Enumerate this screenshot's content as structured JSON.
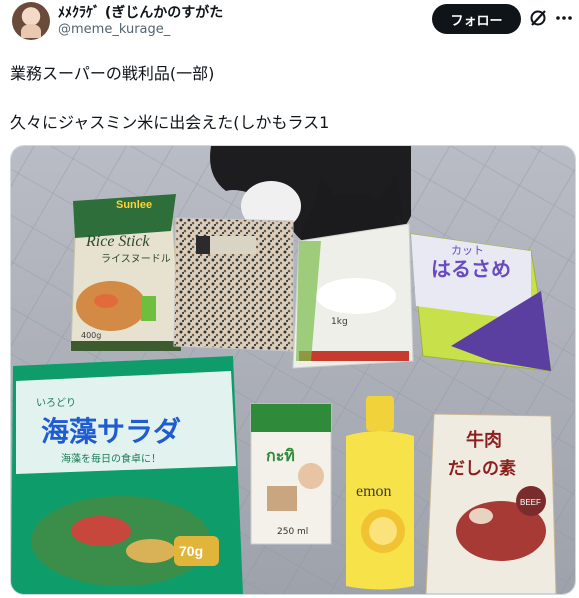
{
  "post": {
    "author_name": "ﾒﾒｸﾗｹﾞ (ぎじんかのすがた",
    "author_handle": "@meme_kurage_",
    "follow_label": "フォロー",
    "text_line1": "業務スーパーの戦利品(一部)",
    "text_line2": "久々にジャスミン米に出会えた(しかもラス1"
  },
  "photo": {
    "noodle_brand": "Sunlee",
    "noodle_name": "Rice Stick",
    "noodle_sub": "ライスヌードル",
    "noodle_weight": "400g",
    "harusame_label": "カット",
    "harusame_name": "はるさめ",
    "rice_weight": "1kg",
    "salad_name": "海藻サラダ",
    "salad_prefix": "いろどり",
    "salad_weight": "70g",
    "salad_tagline": "海藻を毎日の食卓に！",
    "coconut_name": "กะทิ",
    "coconut_volume": "250 ml",
    "lemon_label": "emon",
    "beef_name": "牛肉",
    "beef_sub": "だしの素",
    "beef_badge": "BEEF"
  }
}
